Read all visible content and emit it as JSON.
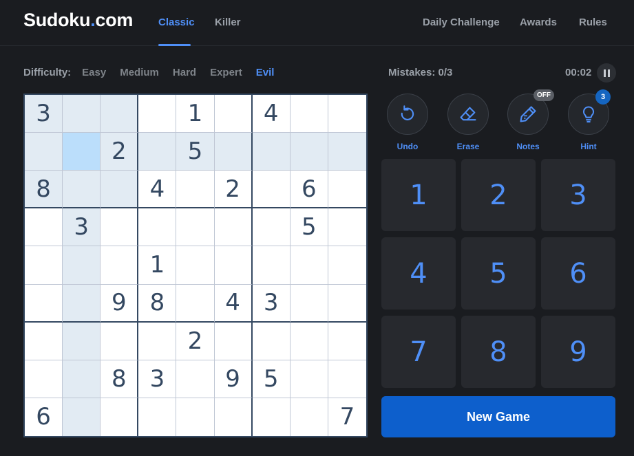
{
  "header": {
    "logo": "Sudoku",
    "logo_dot": ".",
    "logo_suffix": "com",
    "nav_left": [
      {
        "label": "Classic",
        "active": true
      },
      {
        "label": "Killer",
        "active": false
      }
    ],
    "nav_right": [
      {
        "label": "Daily Challenge"
      },
      {
        "label": "Awards"
      },
      {
        "label": "Rules"
      }
    ]
  },
  "difficulty": {
    "label": "Difficulty:",
    "options": [
      "Easy",
      "Medium",
      "Hard",
      "Expert",
      "Evil"
    ],
    "selected": "Evil"
  },
  "status": {
    "mistakes": "Mistakes: 0/3",
    "timer": "00:02"
  },
  "board": {
    "grid": [
      [
        "3",
        "",
        "",
        "",
        "1",
        "",
        "4",
        "",
        ""
      ],
      [
        "",
        "",
        "2",
        "",
        "5",
        "",
        "",
        "",
        ""
      ],
      [
        "8",
        "",
        "",
        "4",
        "",
        "2",
        "",
        "6",
        ""
      ],
      [
        "",
        "3",
        "",
        "",
        "",
        "",
        "",
        "5",
        ""
      ],
      [
        "",
        "",
        "",
        "1",
        "",
        "",
        "",
        "",
        ""
      ],
      [
        "",
        "",
        "9",
        "8",
        "",
        "4",
        "3",
        "",
        ""
      ],
      [
        "",
        "",
        "",
        "",
        "2",
        "",
        "",
        "",
        ""
      ],
      [
        "",
        "",
        "8",
        "3",
        "",
        "9",
        "5",
        "",
        ""
      ],
      [
        "6",
        "",
        "",
        "",
        "",
        "",
        "",
        "",
        "7"
      ]
    ],
    "selected_cell": [
      1,
      1
    ],
    "colors": {
      "background": "#ffffff",
      "highlight": "#e2ebf3",
      "same_number": "#c3d7ea",
      "selected": "#bbdefb",
      "digit": "#344861"
    }
  },
  "tools": [
    {
      "label": "Undo",
      "icon": "undo-icon"
    },
    {
      "label": "Erase",
      "icon": "eraser-icon"
    },
    {
      "label": "Notes",
      "icon": "pencil-icon",
      "badge": "OFF"
    },
    {
      "label": "Hint",
      "icon": "lightbulb-icon",
      "badge": "3"
    }
  ],
  "numpad": [
    "1",
    "2",
    "3",
    "4",
    "5",
    "6",
    "7",
    "8",
    "9"
  ],
  "new_game_label": "New Game",
  "theme": {
    "accent": "#4f8ff7",
    "page_bg": "#1a1c20",
    "button_bg": "#0d5fcc"
  }
}
